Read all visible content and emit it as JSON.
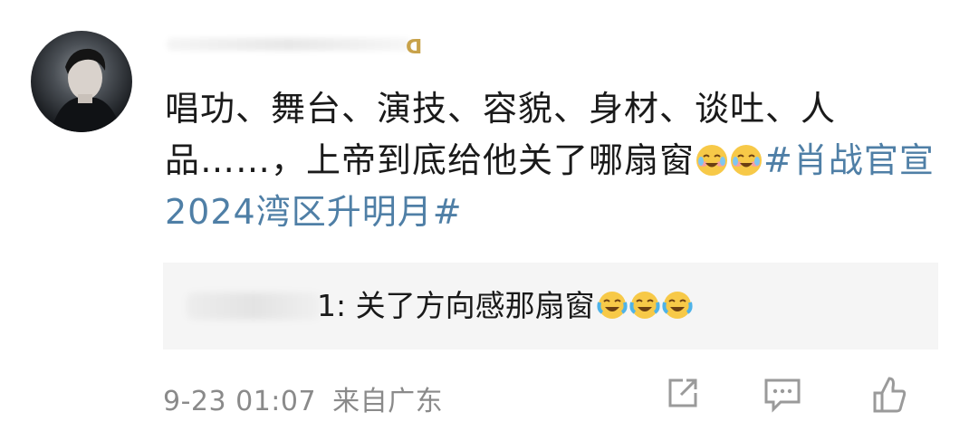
{
  "post": {
    "text": "唱功、舞台、演技、容貌、身材、谈吐、人品……，上帝到底给他关了哪扇窗",
    "emojis": [
      "laugh-cry-blush-emoji",
      "laugh-cry-blush-emoji"
    ],
    "topic": "#肖战官宣2024湾区升明月#"
  },
  "repost": {
    "suffix": "1:",
    "text": "关了方向感那扇窗",
    "emojis": [
      "crying-laughing-emoji",
      "crying-laughing-emoji",
      "crying-laughing-emoji"
    ]
  },
  "meta": {
    "time": "9-23 01:07",
    "source": "来自广东"
  },
  "icons": {
    "share": "share-icon",
    "comment": "comment-icon",
    "like": "like-icon"
  },
  "colors": {
    "topic": "#4f7fa6",
    "meta": "#8a8a8a",
    "repost_bg": "#f5f5f5"
  }
}
